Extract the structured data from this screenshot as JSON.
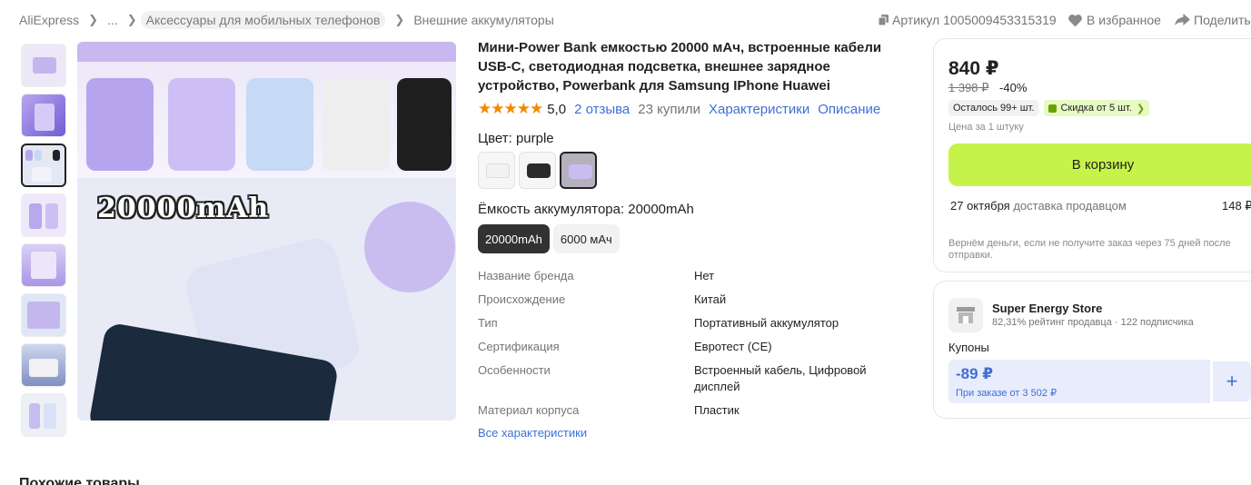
{
  "breadcrumb": {
    "items": [
      "AliExpress",
      "...",
      "Аксессуары для мобильных телефонов",
      "Внешние аккумуляторы"
    ]
  },
  "header_actions": {
    "article": "Артикул 1005009453315319",
    "favorite": "В избранное",
    "share": "Поделить"
  },
  "gallery": {
    "main_image_text": "20000mAh",
    "thumbnail_count": 8,
    "active_index": 2
  },
  "product": {
    "title": "Мини-Power Bank емкостью 20000 мАч, встроенные кабели USB-C, светодиодная подсветка, внешнее зарядное устройство, Powerbank для Samsung IPhone Huawei",
    "stars": "★★★★★",
    "rating": "5,0",
    "reviews": "2 отзыва",
    "bought": "23 купили",
    "characteristics_link": "Характеристики",
    "description_link": "Описание",
    "color_label": "Цвет: purple",
    "capacity_label": "Ёмкость аккумулятора: 20000mAh",
    "capacity_options": [
      "20000mAh",
      "6000 мАч"
    ],
    "specs": [
      {
        "k": "Название бренда",
        "v": "Нет"
      },
      {
        "k": "Происхождение",
        "v": "Китай"
      },
      {
        "k": "Тип",
        "v": "Портативный аккумулятор"
      },
      {
        "k": "Сертификация",
        "v": "Евротест (CE)"
      },
      {
        "k": "Особенности",
        "v": "Встроенный кабель, Цифровой дисплей"
      },
      {
        "k": "Материал корпуса",
        "v": "Пластик"
      }
    ],
    "all_specs_link": "Все характеристики"
  },
  "buy": {
    "price": "840 ₽",
    "old_price": "1 398 ₽",
    "discount": "-40%",
    "stock_badge": "Осталось 99+ шт.",
    "bulk_badge": "Скидка от 5 шт.",
    "unit_note": "Цена за 1 штуку",
    "cart_button": "В корзину",
    "delivery_date": "27 октября",
    "delivery_by": "доставка продавцом",
    "delivery_price": "148 ₽",
    "refund_note": "Вернём деньги, если не получите заказ через 75 дней после отправки."
  },
  "store": {
    "name": "Super Energy Store",
    "subline": "82,31% рейтинг продавца · 122 подписчика",
    "coupons_label": "Купоны",
    "coupon_amount": "-89 ₽",
    "coupon_min": "При заказе от 3 502 ₽",
    "coupon_add": "+"
  },
  "related_heading": "Похожие товары",
  "colors": {
    "accent_link": "#3e6fd6",
    "cart_green": "#c6f349",
    "star_orange": "#f08a00"
  }
}
